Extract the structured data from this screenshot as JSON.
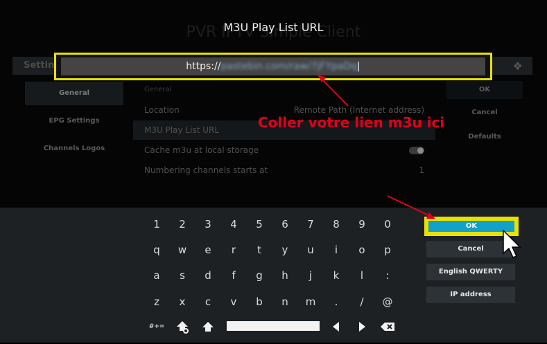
{
  "background": {
    "title": "PVR IPTV Simple Client",
    "settings_label": "Settings",
    "sidebar": [
      "General",
      "EPG Settings",
      "Channels Logos"
    ],
    "group_label": "General",
    "rows": [
      {
        "label": "Location",
        "value": "Remote Path (Internet address)"
      },
      {
        "label": "M3U Play List URL",
        "value": ""
      },
      {
        "label": "Cache m3u at local storage",
        "value": ""
      },
      {
        "label": "Numbering channels starts at",
        "value": "1"
      }
    ],
    "right_buttons": [
      "OK",
      "Cancel",
      "Defaults"
    ]
  },
  "dialog": {
    "title": "M3U Play List URL",
    "url_prefix": "https://",
    "url_blurred": "pastebin.com/raw/7jFYpaDq",
    "cursor": "|"
  },
  "annotation": {
    "text": "Coller  votre lien m3u ici",
    "color": "#e0001a"
  },
  "keyboard": {
    "rows": [
      [
        "1",
        "2",
        "3",
        "4",
        "5",
        "6",
        "7",
        "8",
        "9",
        "0"
      ],
      [
        "q",
        "w",
        "e",
        "r",
        "t",
        "y",
        "u",
        "i",
        "o",
        "p"
      ],
      [
        "a",
        "s",
        "d",
        "f",
        "g",
        "h",
        "j",
        "k",
        "l",
        ":"
      ],
      [
        "z",
        "x",
        "c",
        "v",
        "b",
        "n",
        "m",
        ".",
        "/",
        "@"
      ]
    ],
    "symbols_key": "#+=",
    "buttons": {
      "ok": "OK",
      "cancel": "Cancel",
      "layout": "English QWERTY",
      "ip": "IP address"
    }
  },
  "colors": {
    "highlight": "#e8e200",
    "ok_button": "#12a1c8",
    "keyboard_bg": "#1e2124"
  }
}
